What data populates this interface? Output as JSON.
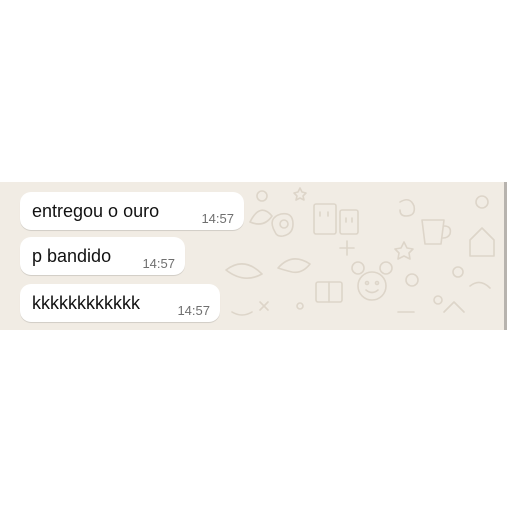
{
  "chat": {
    "background_color": "#f1ece4",
    "bubble_color": "#ffffff",
    "messages": [
      {
        "text": "entregou o ouro",
        "time": "14:57"
      },
      {
        "text": "p bandido",
        "time": "14:57"
      },
      {
        "text": "kkkkkkkkkkkk",
        "time": "14:57"
      }
    ]
  }
}
